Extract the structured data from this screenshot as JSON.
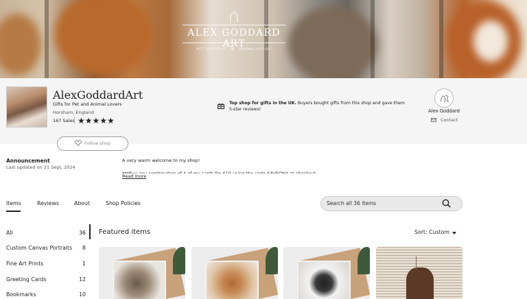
{
  "banner": {
    "title": "ALEX GODDARD ART",
    "subtitle_left": "PET PORTRAIT",
    "subtitle_amp": "&",
    "subtitle_right": "ANIMAL ARTIST"
  },
  "shop": {
    "name": "AlexGoddardArt",
    "tagline": "Gifts for Pet and Animal Lovers",
    "location": "Horsham, England",
    "sales": "167 Sales",
    "rating": 5,
    "stars": "★★★★★"
  },
  "gift_info": {
    "bold": "Top shop for gifts in the UK.",
    "text": " Buyers bought gifts from this shop and gave them 5-star reviews!"
  },
  "owner": {
    "name": "Alex Goddard",
    "contact_label": "Contact"
  },
  "follow": {
    "label": "Follow shop"
  },
  "announcement": {
    "title": "Announcement",
    "date": "Last updated on 21 Sept, 2024",
    "text": "A very warm welcome to my shop!",
    "text2": "***Buy any combination of 4 of my cards for £10 using the code SAVEON4 at checkout",
    "read_more": "Read more"
  },
  "tabs": [
    {
      "label": "Items"
    },
    {
      "label": "Reviews"
    },
    {
      "label": "About"
    },
    {
      "label": "Shop Policies"
    }
  ],
  "search": {
    "placeholder": "Search all 36 items"
  },
  "sidebar": {
    "items": [
      {
        "label": "All",
        "count": "36"
      },
      {
        "label": "Custom Canvas Portraits",
        "count": "8"
      },
      {
        "label": "Fine Art Prints",
        "count": "1"
      },
      {
        "label": "Greeting Cards",
        "count": "12"
      },
      {
        "label": "Bookmarks",
        "count": "10"
      }
    ]
  },
  "featured": {
    "title": "Featured items",
    "sort_label": "Sort: Custom"
  },
  "colors": {
    "text": "#222222",
    "band_bg": "#f5f5f5",
    "search_bg": "#e9e9e9"
  }
}
